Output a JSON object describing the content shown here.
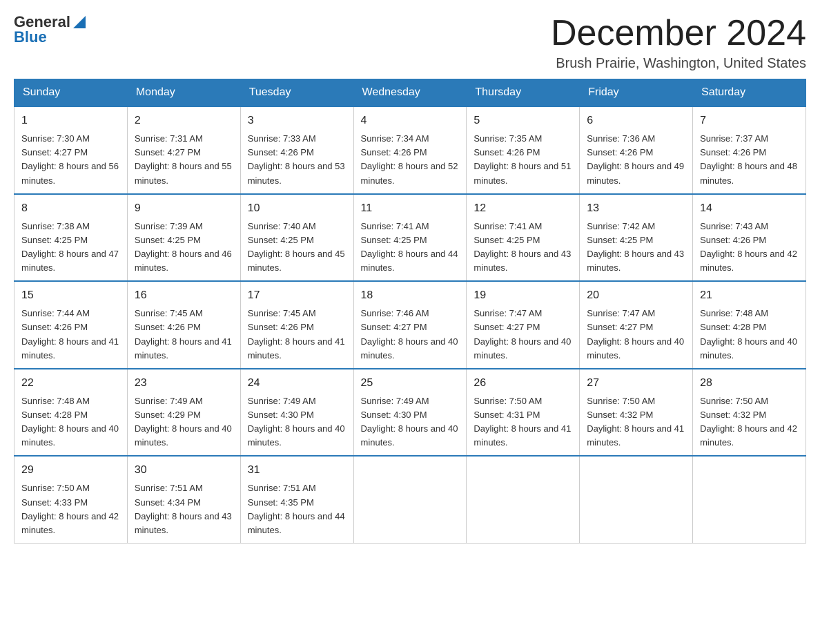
{
  "logo": {
    "text_general": "General",
    "text_blue": "Blue"
  },
  "header": {
    "month": "December 2024",
    "location": "Brush Prairie, Washington, United States"
  },
  "weekdays": [
    "Sunday",
    "Monday",
    "Tuesday",
    "Wednesday",
    "Thursday",
    "Friday",
    "Saturday"
  ],
  "weeks": [
    [
      {
        "day": "1",
        "sunrise": "7:30 AM",
        "sunset": "4:27 PM",
        "daylight": "8 hours and 56 minutes."
      },
      {
        "day": "2",
        "sunrise": "7:31 AM",
        "sunset": "4:27 PM",
        "daylight": "8 hours and 55 minutes."
      },
      {
        "day": "3",
        "sunrise": "7:33 AM",
        "sunset": "4:26 PM",
        "daylight": "8 hours and 53 minutes."
      },
      {
        "day": "4",
        "sunrise": "7:34 AM",
        "sunset": "4:26 PM",
        "daylight": "8 hours and 52 minutes."
      },
      {
        "day": "5",
        "sunrise": "7:35 AM",
        "sunset": "4:26 PM",
        "daylight": "8 hours and 51 minutes."
      },
      {
        "day": "6",
        "sunrise": "7:36 AM",
        "sunset": "4:26 PM",
        "daylight": "8 hours and 49 minutes."
      },
      {
        "day": "7",
        "sunrise": "7:37 AM",
        "sunset": "4:26 PM",
        "daylight": "8 hours and 48 minutes."
      }
    ],
    [
      {
        "day": "8",
        "sunrise": "7:38 AM",
        "sunset": "4:25 PM",
        "daylight": "8 hours and 47 minutes."
      },
      {
        "day": "9",
        "sunrise": "7:39 AM",
        "sunset": "4:25 PM",
        "daylight": "8 hours and 46 minutes."
      },
      {
        "day": "10",
        "sunrise": "7:40 AM",
        "sunset": "4:25 PM",
        "daylight": "8 hours and 45 minutes."
      },
      {
        "day": "11",
        "sunrise": "7:41 AM",
        "sunset": "4:25 PM",
        "daylight": "8 hours and 44 minutes."
      },
      {
        "day": "12",
        "sunrise": "7:41 AM",
        "sunset": "4:25 PM",
        "daylight": "8 hours and 43 minutes."
      },
      {
        "day": "13",
        "sunrise": "7:42 AM",
        "sunset": "4:25 PM",
        "daylight": "8 hours and 43 minutes."
      },
      {
        "day": "14",
        "sunrise": "7:43 AM",
        "sunset": "4:26 PM",
        "daylight": "8 hours and 42 minutes."
      }
    ],
    [
      {
        "day": "15",
        "sunrise": "7:44 AM",
        "sunset": "4:26 PM",
        "daylight": "8 hours and 41 minutes."
      },
      {
        "day": "16",
        "sunrise": "7:45 AM",
        "sunset": "4:26 PM",
        "daylight": "8 hours and 41 minutes."
      },
      {
        "day": "17",
        "sunrise": "7:45 AM",
        "sunset": "4:26 PM",
        "daylight": "8 hours and 41 minutes."
      },
      {
        "day": "18",
        "sunrise": "7:46 AM",
        "sunset": "4:27 PM",
        "daylight": "8 hours and 40 minutes."
      },
      {
        "day": "19",
        "sunrise": "7:47 AM",
        "sunset": "4:27 PM",
        "daylight": "8 hours and 40 minutes."
      },
      {
        "day": "20",
        "sunrise": "7:47 AM",
        "sunset": "4:27 PM",
        "daylight": "8 hours and 40 minutes."
      },
      {
        "day": "21",
        "sunrise": "7:48 AM",
        "sunset": "4:28 PM",
        "daylight": "8 hours and 40 minutes."
      }
    ],
    [
      {
        "day": "22",
        "sunrise": "7:48 AM",
        "sunset": "4:28 PM",
        "daylight": "8 hours and 40 minutes."
      },
      {
        "day": "23",
        "sunrise": "7:49 AM",
        "sunset": "4:29 PM",
        "daylight": "8 hours and 40 minutes."
      },
      {
        "day": "24",
        "sunrise": "7:49 AM",
        "sunset": "4:30 PM",
        "daylight": "8 hours and 40 minutes."
      },
      {
        "day": "25",
        "sunrise": "7:49 AM",
        "sunset": "4:30 PM",
        "daylight": "8 hours and 40 minutes."
      },
      {
        "day": "26",
        "sunrise": "7:50 AM",
        "sunset": "4:31 PM",
        "daylight": "8 hours and 41 minutes."
      },
      {
        "day": "27",
        "sunrise": "7:50 AM",
        "sunset": "4:32 PM",
        "daylight": "8 hours and 41 minutes."
      },
      {
        "day": "28",
        "sunrise": "7:50 AM",
        "sunset": "4:32 PM",
        "daylight": "8 hours and 42 minutes."
      }
    ],
    [
      {
        "day": "29",
        "sunrise": "7:50 AM",
        "sunset": "4:33 PM",
        "daylight": "8 hours and 42 minutes."
      },
      {
        "day": "30",
        "sunrise": "7:51 AM",
        "sunset": "4:34 PM",
        "daylight": "8 hours and 43 minutes."
      },
      {
        "day": "31",
        "sunrise": "7:51 AM",
        "sunset": "4:35 PM",
        "daylight": "8 hours and 44 minutes."
      },
      null,
      null,
      null,
      null
    ]
  ]
}
